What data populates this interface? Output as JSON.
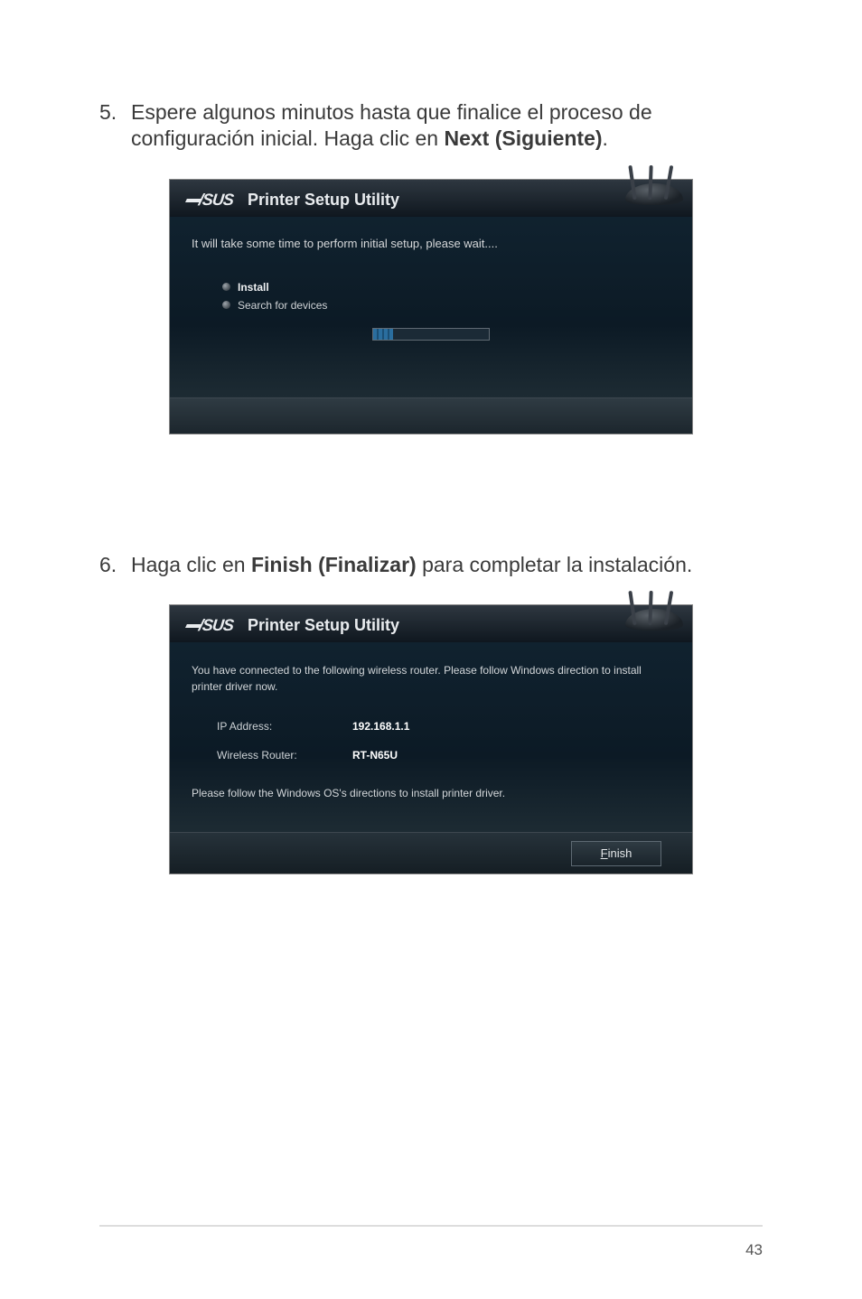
{
  "steps": {
    "s5": {
      "num": "5.",
      "pre": "Espere algunos minutos hasta que finalice el proceso de configuración inicial. Haga clic en ",
      "bold": "Next (Siguiente)",
      "post": "."
    },
    "s6": {
      "num": "6.",
      "pre": "Haga clic en ",
      "bold": "Finish (Finalizar)",
      "post": " para completar la instalación."
    }
  },
  "dialog1": {
    "brand": "/SUS",
    "title": "Printer Setup Utility",
    "message": "It will take some time to perform initial setup, please wait....",
    "items": {
      "install": "Install",
      "search": "Search for devices"
    }
  },
  "dialog2": {
    "brand": "/SUS",
    "title": "Printer Setup Utility",
    "info": "You have connected to the following wireless router. Please follow Windows direction to install printer driver now.",
    "ip_label": "IP Address:",
    "ip_value": "192.168.1.1",
    "router_label": "Wireless Router:",
    "router_value": "RT-N65U",
    "note": "Please follow the Windows OS's directions to install printer driver.",
    "finish_underline": "F",
    "finish_rest": "inish"
  },
  "page_number": "43"
}
